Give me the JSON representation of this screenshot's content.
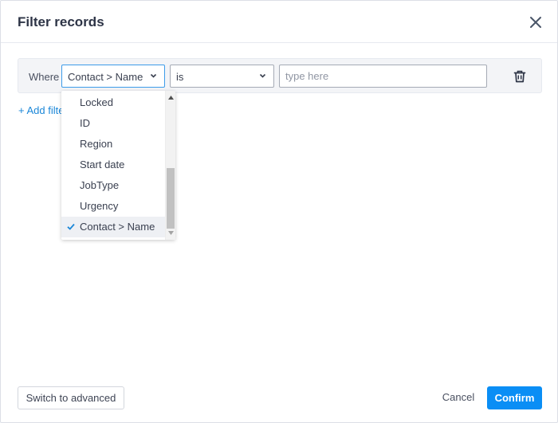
{
  "dialog": {
    "title": "Filter records",
    "close_icon": "close-icon"
  },
  "filter": {
    "where_label": "Where",
    "field_select": {
      "value": "Contact > Name"
    },
    "operator_select": {
      "value": "is"
    },
    "value_input": {
      "value": "",
      "placeholder": "type here"
    },
    "delete_icon": "trash-icon"
  },
  "add_filter_label": "+ Add filter",
  "dropdown": {
    "options": [
      {
        "label": "Locked",
        "selected": false
      },
      {
        "label": "ID",
        "selected": false
      },
      {
        "label": "Region",
        "selected": false
      },
      {
        "label": "Start date",
        "selected": false
      },
      {
        "label": "JobType",
        "selected": false
      },
      {
        "label": "Urgency",
        "selected": false
      },
      {
        "label": "Contact > Name",
        "selected": true
      }
    ],
    "accent_color": "#1b87d8"
  },
  "footer": {
    "switch_label": "Switch to advanced",
    "cancel_label": "Cancel",
    "confirm_label": "Confirm",
    "confirm_color": "#0a8ef5"
  }
}
